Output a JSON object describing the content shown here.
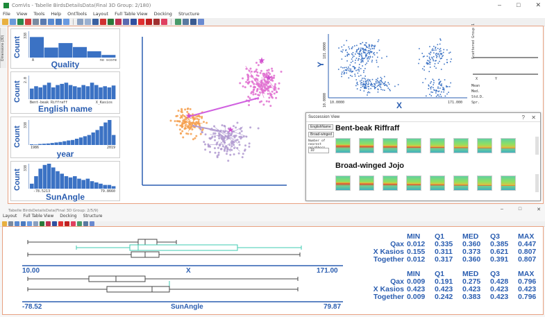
{
  "window1": {
    "title": "ComVis - Tabelle BirdsDetailsData(Final 3D Group: 2/180)",
    "menu": [
      "File",
      "View",
      "Tools",
      "Help",
      "OntTools",
      "Layout",
      "Full Table View",
      "Docking",
      "Structure"
    ]
  },
  "left_tab": "Dimensions (3D)",
  "histograms": [
    {
      "label": "Quality",
      "ymax": "338",
      "left": "A",
      "right": "no score",
      "values": [
        0.78,
        0.38,
        0.55,
        0.4,
        0.24,
        0.1
      ]
    },
    {
      "label": "English name",
      "ymax": "2.0",
      "left": "Bent-beak Riffraff",
      "right": "X_Kasios",
      "values": [
        0.45,
        0.55,
        0.5,
        0.6,
        0.7,
        0.5,
        0.6,
        0.65,
        0.7,
        0.6,
        0.55,
        0.5,
        0.6,
        0.55,
        0.7,
        0.6,
        0.5,
        0.55,
        0.5,
        0.58
      ]
    },
    {
      "label": "year",
      "ymax": "338",
      "left": "1986",
      "right": "2019",
      "values": [
        0.03,
        0.02,
        0.04,
        0.05,
        0.06,
        0.08,
        0.1,
        0.12,
        0.15,
        0.18,
        0.2,
        0.25,
        0.3,
        0.35,
        0.4,
        0.5,
        0.6,
        0.75,
        0.9,
        1.0,
        0.4
      ]
    },
    {
      "label": "SunAngle",
      "ymax": "338",
      "left": "-78.5213",
      "right": "79.8660",
      "values": [
        0.2,
        0.5,
        0.8,
        0.95,
        1.0,
        0.85,
        0.7,
        0.6,
        0.5,
        0.45,
        0.5,
        0.4,
        0.35,
        0.4,
        0.3,
        0.25,
        0.2,
        0.15,
        0.15,
        0.1
      ]
    }
  ],
  "scatter_colors": {
    "pink": "#e070d0",
    "orange": "#f5a050",
    "purple": "#b09ad0",
    "line_magenta": "#d060e0"
  },
  "rightplot": {
    "ylabel": "Y",
    "ymax": "181.0000",
    "ymin": "10.0000",
    "xlabel": "X",
    "xmin": "10.0000",
    "xmax": "171.000",
    "legend_title": "Scattered Group 1",
    "legend_cols": [
      "X",
      "Y"
    ],
    "legend_rows": [
      "Mean",
      "Med.",
      "Std.D.",
      "Spr."
    ]
  },
  "succession": {
    "title": "Succession View",
    "ctl1": "EnglishName",
    "ctl2": "Broad-winged",
    "ctl3": "Number of nearest neighbors",
    "ctl4": "10",
    "species": [
      "Bent-beak Riffraff",
      "Broad-winged Jojo"
    ]
  },
  "window2": {
    "title": "Tabelle BirdsDetailsData(Final 3D Group: 2/5/9)",
    "menu": [
      "Layout",
      "Full Table View",
      "Docking",
      "Structure"
    ]
  },
  "boxplots": {
    "x_axis": {
      "label": "X",
      "min": "10.00",
      "max": "171.00"
    },
    "sun_axis": {
      "label": "SunAngle",
      "min": "-78.52",
      "max": "79.87"
    }
  },
  "stats_x": {
    "headers": [
      "MIN",
      "Q1",
      "MED",
      "Q3",
      "MAX"
    ],
    "rows": [
      {
        "name": "Qax",
        "values": [
          "0.012",
          "0.335",
          "0.360",
          "0.385",
          "0.447"
        ]
      },
      {
        "name": "X Kasios",
        "values": [
          "0.155",
          "0.311",
          "0.373",
          "0.621",
          "0.807"
        ]
      },
      {
        "name": "Together",
        "values": [
          "0.012",
          "0.317",
          "0.360",
          "0.391",
          "0.807"
        ]
      }
    ]
  },
  "stats_sun": {
    "headers": [
      "MIN",
      "Q1",
      "MED",
      "Q3",
      "MAX"
    ],
    "rows": [
      {
        "name": "Qax",
        "values": [
          "0.009",
          "0.191",
          "0.275",
          "0.428",
          "0.796"
        ]
      },
      {
        "name": "X Kasios",
        "values": [
          "0.423",
          "0.423",
          "0.423",
          "0.423",
          "0.423"
        ]
      },
      {
        "name": "Together",
        "values": [
          "0.009",
          "0.242",
          "0.383",
          "0.423",
          "0.796"
        ]
      }
    ]
  }
}
